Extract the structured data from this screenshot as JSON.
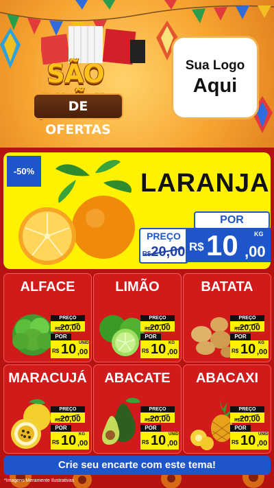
{
  "header": {
    "title_line1": "SÃO JOÃO",
    "title_line2": "DE OFERTAS",
    "logo_line1": "Sua Logo",
    "logo_line2": "Aqui"
  },
  "featured": {
    "discount": "-50%",
    "name": "LARANJA",
    "preco_label": "PREÇO",
    "old_currency": "R$",
    "old_price": "20,00",
    "por_label": "POR",
    "currency": "R$",
    "price_int": "10",
    "price_dec": ",00",
    "unit": "KG"
  },
  "products": [
    {
      "name": "ALFACE",
      "preco_label": "PREÇO",
      "old_currency": "R$",
      "old_price": "20,00",
      "por_label": "POR",
      "currency": "R$",
      "price_int": "10",
      "price_dec": ",00",
      "unit": "UNID"
    },
    {
      "name": "LIMÃO",
      "preco_label": "PREÇO",
      "old_currency": "R$",
      "old_price": "20,00",
      "por_label": "POR",
      "currency": "R$",
      "price_int": "10",
      "price_dec": ",00",
      "unit": "KG"
    },
    {
      "name": "BATATA",
      "preco_label": "PREÇO",
      "old_currency": "R$",
      "old_price": "20,00",
      "por_label": "POR",
      "currency": "R$",
      "price_int": "10",
      "price_dec": ",00",
      "unit": "KG"
    },
    {
      "name": "MARACUJÁ",
      "preco_label": "PREÇO",
      "old_currency": "R$",
      "old_price": "20,00",
      "por_label": "POR",
      "currency": "R$",
      "price_int": "10",
      "price_dec": ",00",
      "unit": "KG"
    },
    {
      "name": "ABACATE",
      "preco_label": "PREÇO",
      "old_currency": "R$",
      "old_price": "20,00",
      "por_label": "POR",
      "currency": "R$",
      "price_int": "10",
      "price_dec": ",00",
      "unit": "UNID"
    },
    {
      "name": "ABACAXI",
      "preco_label": "PREÇO",
      "old_currency": "R$",
      "old_price": "20,00",
      "por_label": "POR",
      "currency": "R$",
      "price_int": "10",
      "price_dec": ",00",
      "unit": "UNID"
    }
  ],
  "footer": {
    "cta": "Crie seu encarte com este tema!",
    "note": "*Imagens Meramente Ilustrativas"
  },
  "colors": {
    "red": "#d11a1a",
    "yellow": "#fff200",
    "blue": "#1e55c9",
    "orange": "#f7a531"
  },
  "icons": [
    "orange-fruit-image",
    "lettuce-image",
    "lime-image",
    "potato-image",
    "passion-fruit-image",
    "avocado-image",
    "pineapple-image",
    "festa-junina-flags-image",
    "lantern-image",
    "sunflower-image"
  ]
}
